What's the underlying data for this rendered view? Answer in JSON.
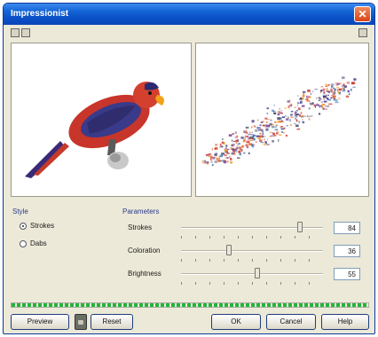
{
  "window": {
    "title": "Impressionist"
  },
  "style": {
    "group_label": "Style",
    "options": [
      {
        "label": "Strokes",
        "selected": true
      },
      {
        "label": "Dabs",
        "selected": false
      }
    ]
  },
  "parameters": {
    "group_label": "Parameters",
    "items": [
      {
        "label": "Strokes",
        "value": "84"
      },
      {
        "label": "Coloration",
        "value": "36"
      },
      {
        "label": "Brightness",
        "value": "55"
      }
    ]
  },
  "buttons": {
    "preview": "Preview",
    "reset": "Reset",
    "ok": "OK",
    "cancel": "Cancel",
    "help": "Help"
  }
}
